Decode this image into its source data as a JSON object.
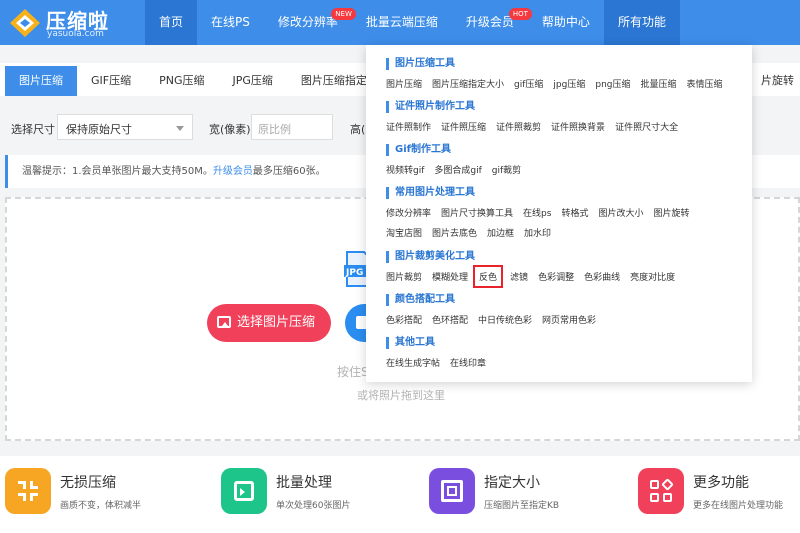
{
  "brand": {
    "name": "压缩啦",
    "domain": "yasuola.com"
  },
  "nav": [
    {
      "label": "首页"
    },
    {
      "label": "在线PS"
    },
    {
      "label": "修改分辨率",
      "badge": "NEW"
    },
    {
      "label": "批量云端压缩"
    },
    {
      "label": "升级会员",
      "badge": "HOT"
    },
    {
      "label": "帮助中心"
    },
    {
      "label": "所有功能"
    }
  ],
  "tabs": [
    "图片压缩",
    "GIF压缩",
    "PNG压缩",
    "JPG压缩",
    "图片压缩指定大小"
  ],
  "tab_right": "片旋转",
  "options": {
    "size_label": "选择尺寸",
    "size_value": "保持原始尺寸",
    "width_label": "宽(像素)",
    "width_placeholder": "原比例",
    "height_label": "高("
  },
  "notice": {
    "prefix": "温馨提示：1.会员单张图片最大支持50M。",
    "link": "升级会员",
    "suffix": "最多压缩60张。"
  },
  "upload": {
    "pick_button": "选择图片压缩",
    "hint_drag": "按住S",
    "hint_drop": "或将照片拖到这里"
  },
  "features": [
    {
      "title": "无损压缩",
      "desc": "画质不变，体积减半",
      "color": "#f7a623"
    },
    {
      "title": "批量处理",
      "desc": "单次处理60张图片",
      "color": "#1dc58a"
    },
    {
      "title": "指定大小",
      "desc": "压缩图片至指定KB",
      "color": "#7a4fe0"
    },
    {
      "title": "更多功能",
      "desc": "更多在线图片处理功能",
      "color": "#f0405a"
    }
  ],
  "dropdown": {
    "sections": [
      {
        "title": "图片压缩工具",
        "rows": [
          [
            "图片压缩",
            "图片压缩指定大小",
            "gif压缩",
            "jpg压缩",
            "png压缩",
            "批量压缩",
            "表情压缩"
          ]
        ]
      },
      {
        "title": "证件照片制作工具",
        "rows": [
          [
            "证件照制作",
            "证件照压缩",
            "证件照裁剪",
            "证件照换背景",
            "证件照尺寸大全"
          ]
        ]
      },
      {
        "title": "Gif制作工具",
        "rows": [
          [
            "视频转gif",
            "多图合成gif",
            "gif裁剪"
          ]
        ]
      },
      {
        "title": "常用图片处理工具",
        "rows": [
          [
            "修改分辨率",
            "图片尺寸换算工具",
            "在线ps",
            "转格式",
            "图片改大小",
            "图片旋转"
          ],
          [
            "淘宝店图",
            "图片去底色",
            "加边框",
            "加水印"
          ]
        ]
      },
      {
        "title": "图片裁剪美化工具",
        "rows": [
          [
            "图片裁剪",
            "模糊处理",
            "反色",
            "滤镜",
            "色彩调整",
            "色彩曲线",
            "亮度对比度"
          ]
        ]
      },
      {
        "title": "颜色搭配工具",
        "rows": [
          [
            "色彩搭配",
            "色环搭配",
            "中日传统色彩",
            "网页常用色彩"
          ]
        ]
      },
      {
        "title": "其他工具",
        "rows": [
          [
            "在线生成字帖",
            "在线印章"
          ]
        ]
      }
    ],
    "highlighted": "反色"
  },
  "colors": {
    "primary": "#3d8de9",
    "accent": "#f0405a",
    "highlight_border": "#e8232b"
  }
}
